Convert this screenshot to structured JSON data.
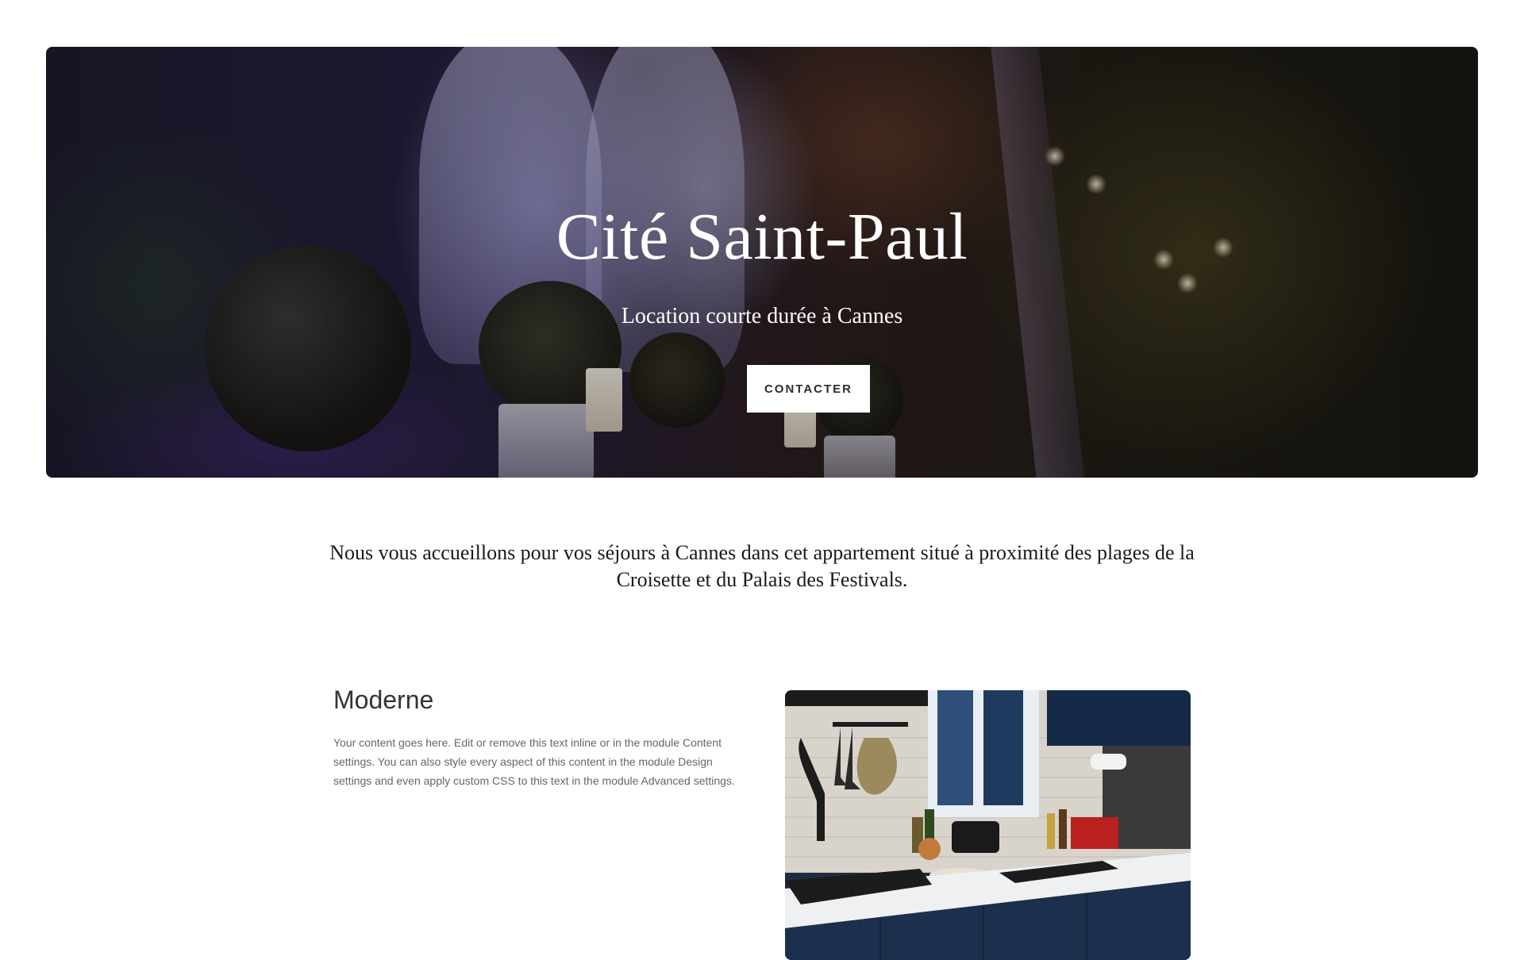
{
  "hero": {
    "title": "Cité Saint-Paul",
    "subtitle": "Location courte durée à Cannes",
    "button_label": "CONTACTER"
  },
  "intro": {
    "text": "Nous vous accueillons pour vos séjours à Cannes dans cet appartement situé à proximité des plages de la Croisette et du Palais des Festivals."
  },
  "feature": {
    "heading": "Moderne",
    "body": "Your content goes here. Edit or remove this text inline or in the module Content settings. You can also style every aspect of this content in the module Design settings and even apply custom CSS to this text in the module Advanced settings."
  },
  "colors": {
    "background": "#ffffff",
    "hero_text": "#ffffff",
    "button_bg": "#ffffff",
    "button_text": "#2c2c2c",
    "heading_text": "#333333",
    "body_text": "#666666"
  }
}
